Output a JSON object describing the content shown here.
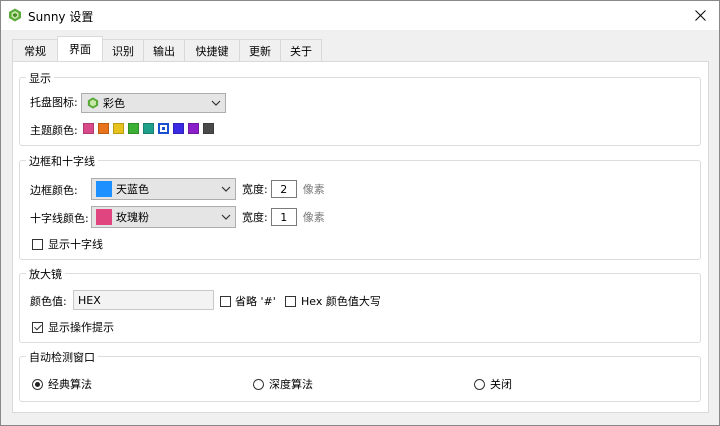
{
  "window": {
    "title": "Sunny 设置"
  },
  "tabs": [
    "常规",
    "界面",
    "识别",
    "输出",
    "快捷键",
    "更新",
    "关于"
  ],
  "active_tab": 1,
  "display": {
    "title": "显示",
    "tray_label": "托盘图标:",
    "tray_value": "彩色",
    "theme_label": "主题颜色:",
    "theme_colors": [
      "#d94a8a",
      "#e8731c",
      "#e8c21c",
      "#3cb034",
      "#1fa08a",
      "#1a4fcf",
      "#3a2ae6",
      "#8a1ec8",
      "#4a4a4a"
    ],
    "theme_selected": 5
  },
  "border": {
    "title": "边框和十字线",
    "border_color_label": "边框颜色:",
    "border_color_value": "天蓝色",
    "border_color_hex": "#1e90ff",
    "border_width_label": "宽度:",
    "border_width_value": "2",
    "border_unit": "像素",
    "cross_color_label": "十字线颜色:",
    "cross_color_value": "玫瑰粉",
    "cross_color_hex": "#e0457f",
    "cross_width_label": "宽度:",
    "cross_width_value": "1",
    "cross_unit": "像素",
    "show_cross_label": "显示十字线",
    "show_cross_checked": false
  },
  "magnifier": {
    "title": "放大镜",
    "color_value_label": "颜色值:",
    "color_value": "HEX",
    "omit_hash_label": "省略 '#'",
    "omit_hash_checked": false,
    "hex_upper_label": "Hex 颜色值大写",
    "hex_upper_checked": false,
    "show_tips_label": "显示操作提示",
    "show_tips_checked": true
  },
  "detect": {
    "title": "自动检测窗口",
    "options": [
      "经典算法",
      "深度算法",
      "关闭"
    ],
    "selected": 0
  }
}
